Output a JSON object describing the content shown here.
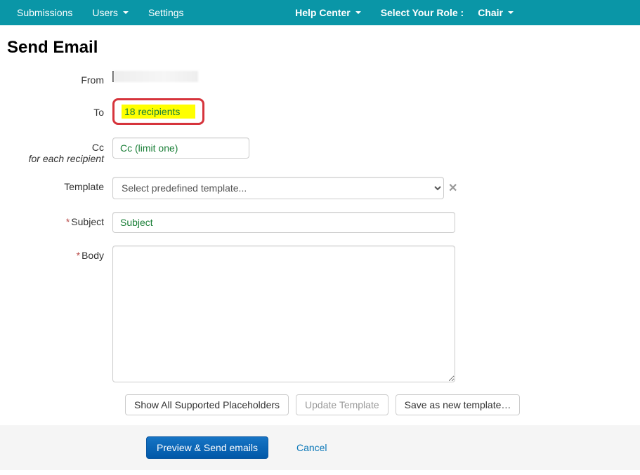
{
  "nav": {
    "left": {
      "submissions": "Submissions",
      "users": "Users",
      "settings": "Settings"
    },
    "right": {
      "help_center": "Help Center",
      "select_role_label": "Select Your Role :",
      "role": "Chair"
    }
  },
  "page_title": "Send Email",
  "form": {
    "from_label": "From",
    "to_label": "To",
    "to_recipients": "18 recipients",
    "cc_label": "Cc",
    "cc_sub": "for each recipient",
    "cc_placeholder": "Cc (limit one)",
    "template_label": "Template",
    "template_placeholder": "Select predefined template...",
    "subject_label": "Subject",
    "subject_placeholder": "Subject",
    "body_label": "Body"
  },
  "buttons": {
    "show_placeholders": "Show All Supported Placeholders",
    "update_template": "Update Template",
    "save_new_template": "Save as new template…",
    "preview_send": "Preview & Send emails",
    "cancel": "Cancel"
  }
}
